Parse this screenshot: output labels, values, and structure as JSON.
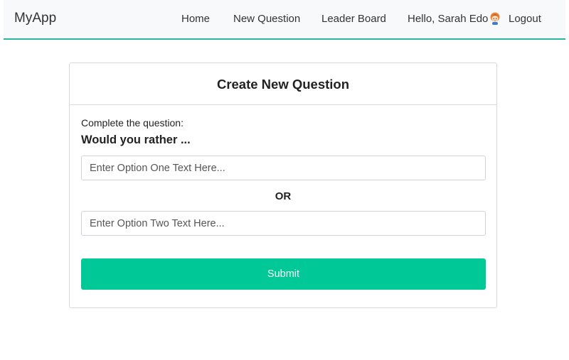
{
  "navbar": {
    "brand": "MyApp",
    "links": {
      "home": "Home",
      "new_question": "New Question",
      "leader_board": "Leader Board"
    },
    "greeting": "Hello, Sarah Edo",
    "avatar_icon": "avatar-icon",
    "logout": "Logout"
  },
  "card": {
    "title": "Create New Question",
    "prompt_label": "Complete the question:",
    "prompt_heading": "Would you rather ...",
    "option_one": {
      "value": "",
      "placeholder": "Enter Option One Text Here..."
    },
    "or_text": "OR",
    "option_two": {
      "value": "",
      "placeholder": "Enter Option Two Text Here..."
    },
    "submit_label": "Submit"
  },
  "colors": {
    "accent": "#00c896",
    "navbar_border": "#2ab5a0",
    "navbar_bg": "#f8f9fa"
  }
}
